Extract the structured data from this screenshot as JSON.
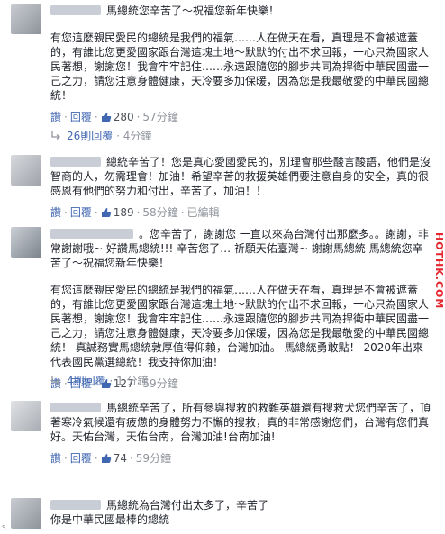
{
  "comments": [
    {
      "lead": "馬總統您辛苦了～祝福您新年快樂！",
      "body": "有您這麼親民愛民的總統是我們的福氣……人在做天在看，真理是不會被遮蓋的，有誰比您更愛國家跟台灣這塊土地～默默的付出不求回報，一心只為國家人民著想，謝謝您！我會牢牢記住……永遠跟隨您的腳步共同為捍衛中華民國盡一己之力，請您注意身體健康，天冷要多加保暖，因為您是我最敬愛的中華民國總統！",
      "like_label": "讚",
      "reply_label": "回覆",
      "likes": "280",
      "time": "57分鐘",
      "edited": ""
    },
    {
      "lead": "總統辛苦了！您是真心愛國愛民的，別理會那些酸言酸語，他們是沒智商的人，勿需理會！加油！希望辛苦的救援英雄們要注意自身的安全，真的很感恩有他們的努力和付出，辛苦了，加油！！",
      "body": "",
      "like_label": "讚",
      "reply_label": "回覆",
      "likes": "189",
      "time": "58分鐘",
      "edited": "已編輯"
    },
    {
      "lead": "。您辛苦了，謝謝您 一直以來為台灣付出那麼多。。謝謝，非常謝謝哦~ 好讚馬總統!!! 辛苦您了… 祈願天佑臺灣~ 謝謝馬總統 馬總統您辛苦了～祝福您新年快樂！",
      "body": "有您這麼親民愛民的總統是我們的福氣……人在做天在看，真理是不會被遮蓋的，有誰比您更愛國家跟台灣這塊土地～默默的付出不求回報，一心只為國家人民著想，謝謝您！我會牢牢記住……永遠跟隨您的腳步共同為捍衛中華民國盡一己之力，請您注意身體健康，天冷要多加保暖，因為您是我最敬愛的中華民國總統！ 真誠務實馬總統敦厚值得仰賴，台灣加油。 馬總統勇敢點！ 2020年出來代表國民黨選總統！我支持你加油！",
      "like_label": "讚",
      "reply_label": "回覆",
      "likes": "127",
      "time": "59分鐘",
      "edited": ""
    },
    {
      "lead": "馬總統辛苦了，所有參與搜救的救難英雄還有搜救犬您們辛苦了，頂著寒冷氣候還有疲憊的身體努力不懈的搜救，真的非常感謝您們，台灣有您們真好。天佑台灣，天佑台南，台灣加油!台南加油!",
      "body": "",
      "like_label": "讚",
      "reply_label": "回覆",
      "likes": "74",
      "time": "59分鐘",
      "edited": ""
    },
    {
      "lead": "馬總統為台灣付出太多了，辛苦了",
      "body": "你是中華民國最棒的總統"
    }
  ],
  "reply_threads": [
    {
      "label": "26則回覆",
      "time": "4分鐘"
    },
    {
      "label": "4則回覆",
      "time": "1 分鐘"
    }
  ],
  "side_tag": "HOTHK.COM",
  "corner_mark": "s"
}
